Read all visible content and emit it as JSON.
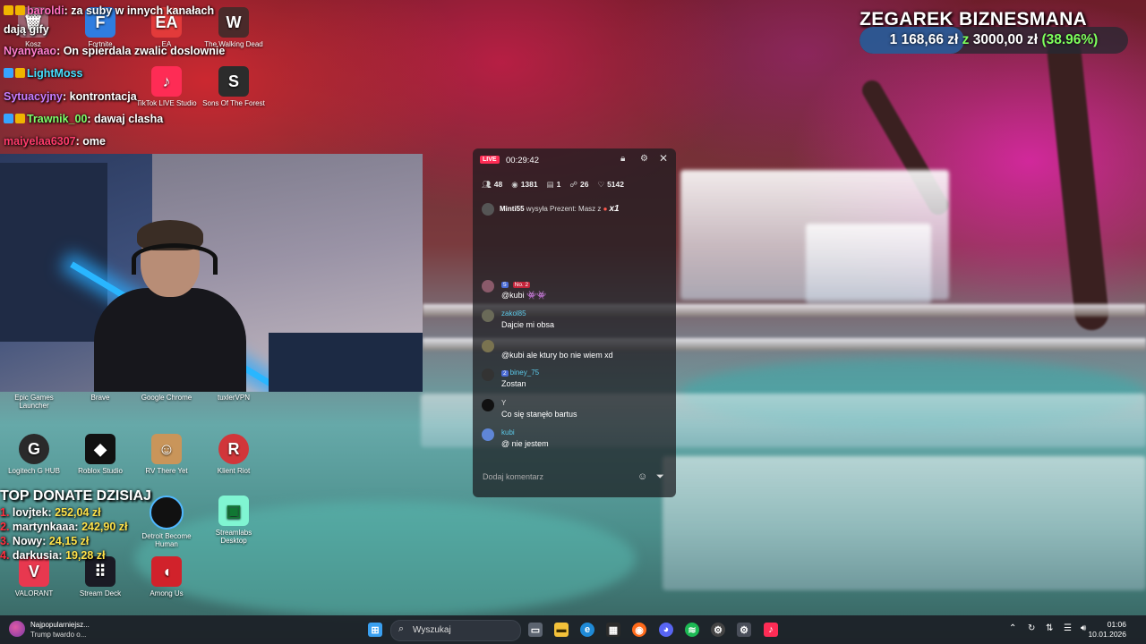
{
  "chat_overlay": {
    "lines": [
      {
        "user": "baroldi",
        "text": ": za suby w innych kanałach"
      },
      {
        "user": "",
        "text": "dają gify"
      },
      {
        "user": "Nyanyaao",
        "text": ": On spierdala zwalic doslownie"
      },
      {
        "user": "LightMoss",
        "text": ""
      },
      {
        "user": "Sytuacyjny",
        "text": ": kontrontacja"
      },
      {
        "user": "Trawnik_00",
        "text": ": dawaj clasha"
      },
      {
        "user": "maiyelaa6307",
        "text": ": ome"
      }
    ]
  },
  "goal": {
    "title": "ZEGAREK BIZNESMANA",
    "current": "1 168,66 zł",
    "separator": "z",
    "target": "3000,00 zł",
    "percent": "(38.96%)",
    "progress_fraction": 0.3896
  },
  "desktop_icons": [
    {
      "label": "Kosz",
      "icon": "recycle-bin-icon"
    },
    {
      "label": "Fortnite",
      "icon": "fortnite-icon"
    },
    {
      "label": "EA",
      "icon": "ea-icon"
    },
    {
      "label": "The Walking Dead",
      "icon": "walking-dead-icon"
    },
    {
      "label": "TikTok LIVE Studio",
      "icon": "tiktok-icon"
    },
    {
      "label": "Sons Of The Forest",
      "icon": "sons-forest-icon"
    },
    {
      "label": "Epic Games Launcher",
      "icon": "epic-games-icon"
    },
    {
      "label": "Brave",
      "icon": "brave-icon"
    },
    {
      "label": "Google Chrome",
      "icon": "chrome-icon"
    },
    {
      "label": "tuxlerVPN",
      "icon": "tuxler-icon"
    },
    {
      "label": "Logitech G HUB",
      "icon": "logitech-icon"
    },
    {
      "label": "Roblox Studio",
      "icon": "roblox-icon"
    },
    {
      "label": "RV There Yet",
      "icon": "rv-icon"
    },
    {
      "label": "Klient Riot",
      "icon": "riot-icon"
    },
    {
      "label": "Detroit Become Human",
      "icon": "detroit-icon"
    },
    {
      "label": "Streamlabs Desktop",
      "icon": "streamlabs-icon"
    },
    {
      "label": "VALORANT",
      "icon": "valorant-icon"
    },
    {
      "label": "Stream Deck",
      "icon": "stream-deck-icon"
    },
    {
      "label": "Among Us",
      "icon": "among-us-icon"
    }
  ],
  "donate": {
    "title": "TOP DONATE DZISIAJ",
    "rows": [
      {
        "rank": "1.",
        "name": "lovjtek:",
        "amount": "252,04 zł"
      },
      {
        "rank": "2.",
        "name": "martynkaaa:",
        "amount": "242,90 zł"
      },
      {
        "rank": "3.",
        "name": "Nowy:",
        "amount": "24,15 zł"
      },
      {
        "rank": "4.",
        "name": "darkusia:",
        "amount": "19,28 zł"
      }
    ]
  },
  "live": {
    "badge": "LIVE",
    "timer": "00:29:42",
    "stats": [
      {
        "icon": "users-icon",
        "value": "48"
      },
      {
        "icon": "eye-icon",
        "value": "1381"
      },
      {
        "icon": "gift-icon",
        "value": "1"
      },
      {
        "icon": "follower-icon",
        "value": "26"
      },
      {
        "icon": "heart-icon",
        "value": "5142"
      }
    ],
    "gift": {
      "user": "Minti55",
      "text": "wysyła Prezent: Masz z",
      "count": "x1"
    },
    "messages": [
      {
        "level": "5",
        "name": "",
        "badge": "No. 2",
        "text": "@kubi 👾👾"
      },
      {
        "level": "",
        "name": "zakol85",
        "badge": "",
        "text": "Dajcie mi obsa"
      },
      {
        "level": "",
        "name": "",
        "badge": "",
        "text": "@kubi ale ktury bo nie wiem xd"
      },
      {
        "level": "2",
        "name": "biney_75",
        "badge": "",
        "text": "Zostan"
      },
      {
        "level": "",
        "name": "Y",
        "badge": "",
        "text": "Co się stanęło bartus"
      },
      {
        "level": "",
        "name": "kubi",
        "badge": "",
        "text": "@ nie jestem"
      }
    ],
    "comment_placeholder": "Dodaj komentarz"
  },
  "taskbar": {
    "news_title": "Najpopularniejsz...",
    "news_sub": "Trump twardo o...",
    "search_placeholder": "Wyszukaj",
    "time": "01:06",
    "date": "10.01.2026"
  }
}
